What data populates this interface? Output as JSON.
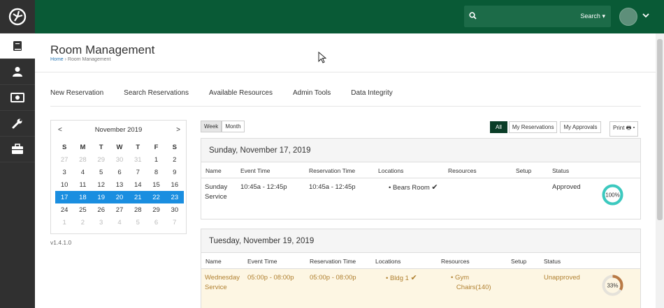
{
  "header": {
    "search_label": "Search"
  },
  "page": {
    "title": "Room Management",
    "breadcrumb_home": "Home",
    "breadcrumb_current": "Room Management"
  },
  "nav": {
    "tabs": [
      "New Reservation",
      "Search Reservations",
      "Available Resources",
      "Admin Tools",
      "Data Integrity"
    ]
  },
  "calendar": {
    "month": "November 2019",
    "prev": "<",
    "next": ">",
    "dow": [
      "S",
      "M",
      "T",
      "W",
      "T",
      "F",
      "S"
    ],
    "weeks": [
      [
        "27",
        "28",
        "29",
        "30",
        "31",
        "1",
        "2"
      ],
      [
        "3",
        "4",
        "5",
        "6",
        "7",
        "8",
        "9"
      ],
      [
        "10",
        "11",
        "12",
        "13",
        "14",
        "15",
        "16"
      ],
      [
        "17",
        "18",
        "19",
        "20",
        "21",
        "22",
        "23"
      ],
      [
        "24",
        "25",
        "26",
        "27",
        "28",
        "29",
        "30"
      ],
      [
        "1",
        "2",
        "3",
        "4",
        "5",
        "6",
        "7"
      ]
    ],
    "selected_week_index": 3
  },
  "version": "v1.4.1.0",
  "view_toggle": {
    "week": "Week",
    "month": "Month"
  },
  "filters": {
    "all": "All",
    "my_reservations": "My Reservations",
    "my_approvals": "My Approvals",
    "print": "Print"
  },
  "columns": {
    "name": "Name",
    "event_time": "Event Time",
    "reservation_time": "Reservation Time",
    "locations": "Locations",
    "resources": "Resources",
    "setup": "Setup",
    "status": "Status"
  },
  "days": [
    {
      "date": "Sunday, November 17, 2019",
      "reservations": [
        {
          "name_line1": "Sunday",
          "name_line2": "Service",
          "event_time": "10:45a - 12:45p",
          "reservation_time": "10:45a - 12:45p",
          "location": "Bears Room",
          "resource_line1": "",
          "resource_line2": "",
          "setup": "",
          "status": "Approved",
          "percent_label": "100%",
          "percent": 100
        }
      ]
    },
    {
      "date": "Tuesday, November 19, 2019",
      "reservations": [
        {
          "name_line1": "Wednesday",
          "name_line2": "Service",
          "event_time": "05:00p - 08:00p",
          "reservation_time": "05:00p - 08:00p",
          "location": "Bldg 1",
          "resource_line1": "Gym",
          "resource_line2": "Chairs(140)",
          "setup": "",
          "status": "Unapproved",
          "percent_label": "33%",
          "percent": 33
        }
      ]
    }
  ],
  "colors": {
    "brand_green": "#095a36",
    "approved_ring": "#3cc9bf",
    "unapproved_ring": "#b97a45",
    "selected_week": "#1a8ee0"
  }
}
